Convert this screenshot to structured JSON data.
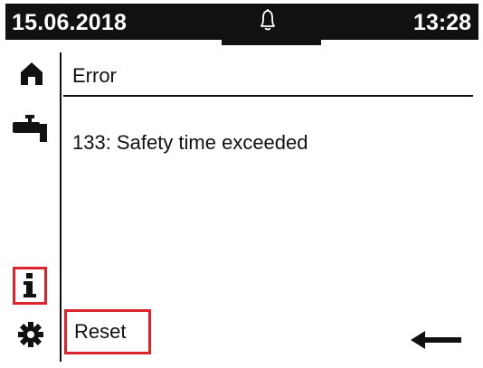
{
  "header": {
    "date": "15.06.2018",
    "time": "13:28",
    "notification_icon": "bell-icon"
  },
  "sidebar": {
    "items": [
      {
        "icon": "home-icon"
      },
      {
        "icon": "tap-icon"
      },
      {
        "icon": "info-icon",
        "selected": true
      },
      {
        "icon": "gear-icon"
      }
    ]
  },
  "content": {
    "title": "Error",
    "message": "133: Safety time exceeded"
  },
  "footer": {
    "reset_label": "Reset",
    "back_icon": "back-arrow-icon"
  },
  "colors": {
    "header_bg": "#111111",
    "highlight": "#d9252b",
    "text": "#111111",
    "background": "#ffffff"
  }
}
